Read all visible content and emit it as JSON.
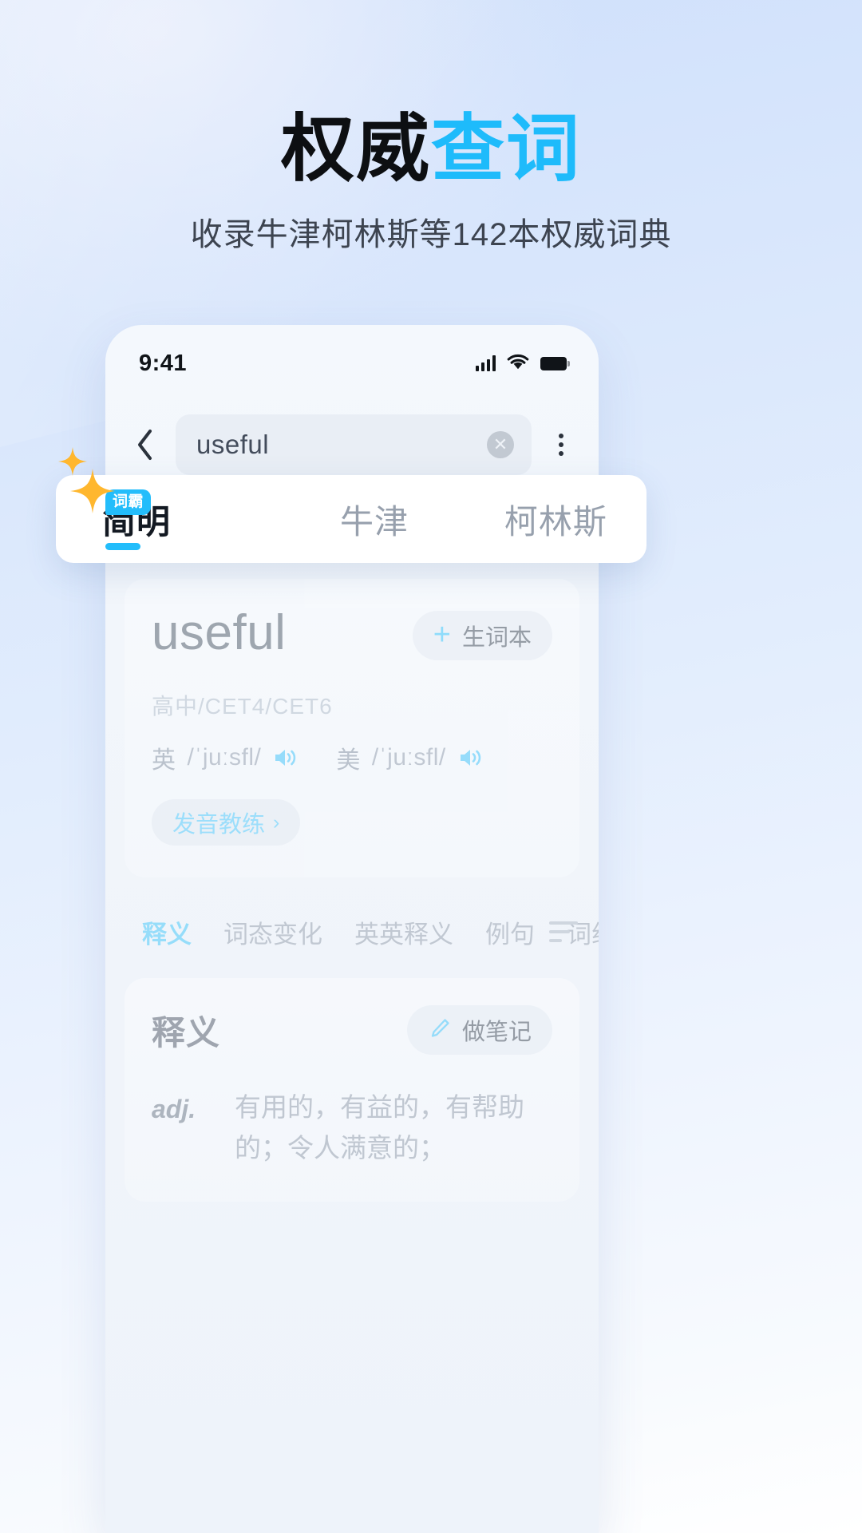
{
  "hero": {
    "title_dark": "权威",
    "title_accent": "查词",
    "subtitle": "收录牛津柯林斯等142本权威词典",
    "accent_color": "#1EBBFB"
  },
  "phone": {
    "status_bar": {
      "time": "9:41",
      "signal_icon": "cellular-signal-icon",
      "wifi_icon": "wifi-icon",
      "battery_icon": "battery-full-icon"
    },
    "search": {
      "back_icon": "chevron-left-icon",
      "value": "useful",
      "placeholder": "useful",
      "clear_icon": "clear-circle-icon",
      "clear_glyph": "✕",
      "more_icon": "more-vertical-icon"
    },
    "dictionary_tabs": {
      "items": [
        {
          "label": "简明",
          "badge": "词霸",
          "active": true
        },
        {
          "label": "牛津",
          "badge": "",
          "active": false
        },
        {
          "label": "柯林斯",
          "badge": "",
          "active": false
        }
      ],
      "badge_color": "#23BDFB",
      "indicator_color": "#22BDFB"
    },
    "entry": {
      "headword": "useful",
      "wordbook_button": {
        "plus": "+",
        "label": "生词本",
        "icon": "plus-icon"
      },
      "tags": "高中/CET4/CET6",
      "pronunciations": [
        {
          "lang": "英",
          "phonetic": "/ˈjuːsfl/",
          "speaker_icon": "speaker-icon"
        },
        {
          "lang": "美",
          "phonetic": "/ˈjuːsfl/",
          "speaker_icon": "speaker-icon"
        }
      ],
      "coach_button": {
        "label": "发音教练",
        "arrow": "›",
        "arrow_icon": "chevron-right-icon"
      }
    },
    "section_tabs": {
      "items": [
        {
          "label": "释义",
          "active": true
        },
        {
          "label": "词态变化",
          "active": false
        },
        {
          "label": "英英释义",
          "active": false
        },
        {
          "label": "例句",
          "active": false
        },
        {
          "label": "词组",
          "active": false
        }
      ],
      "filter_icon": "sort-filter-icon",
      "active_color": "#4ECBFB"
    },
    "definition_card": {
      "title": "释义",
      "note_button": {
        "label": "做笔记",
        "icon": "pencil-icon"
      },
      "entries": [
        {
          "pos": "adj.",
          "text": "有用的，有益的，有帮助的；令人满意的；"
        }
      ]
    }
  },
  "decorations": {
    "sparkle_small_icon": "sparkle-icon",
    "sparkle_big_icon": "sparkle-icon",
    "sparkle_color": "#FFB72E"
  }
}
